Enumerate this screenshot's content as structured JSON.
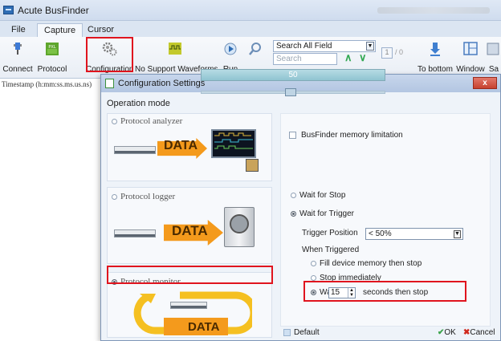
{
  "app": {
    "title": "Acute BusFinder"
  },
  "menu": {
    "tabs": [
      {
        "label": "File"
      },
      {
        "label": "Capture"
      },
      {
        "label": "Cursor"
      }
    ]
  },
  "ribbon": {
    "buttons": [
      {
        "label": "Connect",
        "icon": "connect-icon"
      },
      {
        "label": "Protocol",
        "icon": "protocol-icon"
      },
      {
        "label": "Configuration",
        "icon": "gear-icon"
      },
      {
        "label": "No Support Waveforms",
        "icon": "waveform-icon"
      },
      {
        "label": "Run",
        "icon": "run-icon"
      },
      {
        "label": "To bottom",
        "icon": "arrow-down-icon"
      },
      {
        "label": "Window",
        "icon": "window-icon"
      },
      {
        "label": "Sa",
        "icon": "save-icon"
      }
    ],
    "search_field": "Search All Field",
    "search_placeholder": "Search",
    "page_value": "1",
    "page_total": "/ 0"
  },
  "left": {
    "timestamp_header": "Timestamp (h:mm:ss.ms.us.ns)"
  },
  "dialog": {
    "title": "Configuration Settings",
    "close_label": "x",
    "operation_mode_label": "Operation mode",
    "modes": [
      {
        "label": "Protocol analyzer",
        "selected": false,
        "picture_text": "DATA"
      },
      {
        "label": "Protocol logger",
        "selected": false,
        "picture_text": "DATA"
      },
      {
        "label": "Protocol monitor",
        "selected": true,
        "picture_text": "DATA"
      }
    ],
    "memory_limit_label": "BusFinder memory limitation",
    "memory_limit_checked": false,
    "memory_bar_text": "50",
    "memory_bar_value": 0.5,
    "wait_stop_label": "Wait for Stop",
    "wait_trigger_label": "Wait for Trigger",
    "trigger_position_label": "Trigger Position",
    "trigger_position_value": "< 50%",
    "when_triggered_label": "When Triggered",
    "fill_memory_label": "Fill device memory then stop",
    "stop_immediately_label": "Stop immediately",
    "wait_for_label": "Wait for",
    "wait_seconds": "15",
    "seconds_label": "seconds then stop",
    "default_label": "Default",
    "ok_label": "OK",
    "cancel_label": "Cancel"
  },
  "colors": {
    "highlight": "#e0141e",
    "accent": "#f49a1c"
  }
}
